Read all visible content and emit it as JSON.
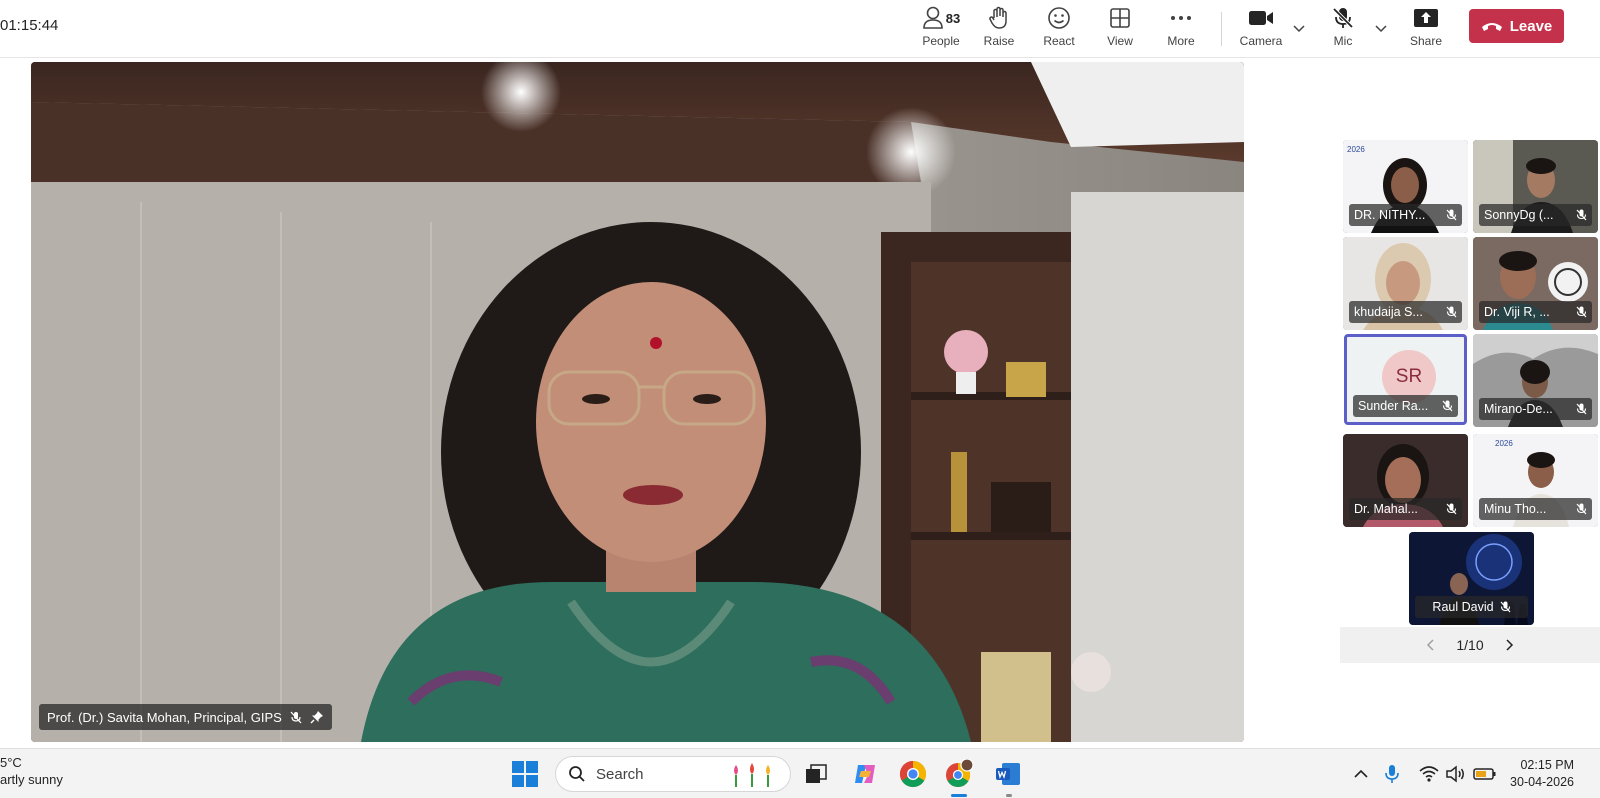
{
  "meeting": {
    "timer": "01:15:44",
    "toolbar": {
      "people_label": "People",
      "people_count": "83",
      "raise_label": "Raise",
      "react_label": "React",
      "view_label": "View",
      "more_label": "More",
      "camera_label": "Camera",
      "mic_label": "Mic",
      "share_label": "Share",
      "leave_label": "Leave"
    },
    "main_speaker": {
      "name": "Prof. (Dr.) Savita Mohan, Principal, GIPS"
    },
    "gallery": {
      "participants": [
        {
          "name": "DR. NITHY..."
        },
        {
          "name": "SonnyDg (..."
        },
        {
          "name": "khudaija S..."
        },
        {
          "name": "Dr. Viji R, ..."
        },
        {
          "name": "Sunder Ra...",
          "initials": "SR"
        },
        {
          "name": "Mirano-De..."
        },
        {
          "name": "Dr. Mahal..."
        },
        {
          "name": "Minu Tho..."
        },
        {
          "name": "Raul David"
        }
      ],
      "banner_text": "2026",
      "page_indicator": "1/10"
    }
  },
  "taskbar": {
    "weather_temp": "5°C",
    "weather_desc": "artly sunny",
    "search_placeholder": "Search",
    "time": "02:15 PM",
    "date": "30-04-2026"
  },
  "colors": {
    "leave_red": "#c4314b",
    "active_speaker_border": "#5b5fc7",
    "avatar_bg": "#f0c8c8"
  }
}
